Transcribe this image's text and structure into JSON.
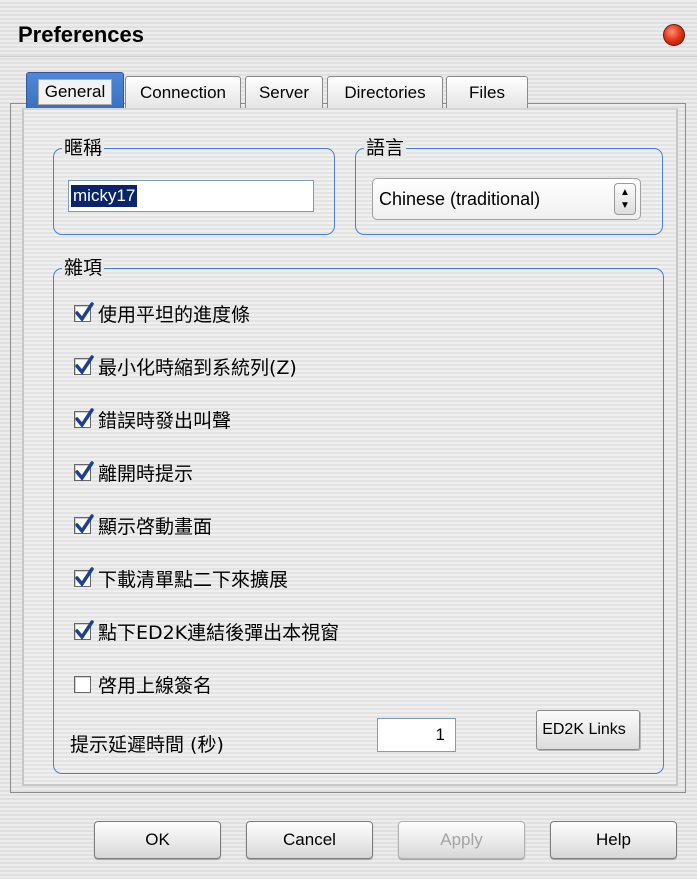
{
  "window": {
    "title": "Preferences"
  },
  "tabs": [
    {
      "label": "General",
      "active": true
    },
    {
      "label": "Connection",
      "active": false
    },
    {
      "label": "Server",
      "active": false
    },
    {
      "label": "Directories",
      "active": false
    },
    {
      "label": "Files",
      "active": false
    }
  ],
  "nickname": {
    "label": "暱稱",
    "value": "micky17"
  },
  "language": {
    "label": "語言",
    "selected": "Chinese (traditional)"
  },
  "misc": {
    "label": "雜項",
    "options": [
      {
        "label": "使用平坦的進度條",
        "checked": true
      },
      {
        "label": "最小化時縮到系統列(Z)",
        "checked": true
      },
      {
        "label": "錯誤時發出叫聲",
        "checked": true
      },
      {
        "label": "離開時提示",
        "checked": true
      },
      {
        "label": "顯示啓動畫面",
        "checked": true
      },
      {
        "label": "下載清單點二下來擴展",
        "checked": true
      },
      {
        "label": "點下ED2K連結後彈出本視窗",
        "checked": true
      },
      {
        "label": "啓用上線簽名",
        "checked": false
      }
    ],
    "delay_label": "提示延遲時間 (秒)",
    "delay_value": "1",
    "ed2k_button": "ED2K Links"
  },
  "buttons": {
    "ok": "OK",
    "cancel": "Cancel",
    "apply": "Apply",
    "help": "Help"
  },
  "colors": {
    "accent": "#4a7fd1",
    "check": "#1f3f8f"
  }
}
